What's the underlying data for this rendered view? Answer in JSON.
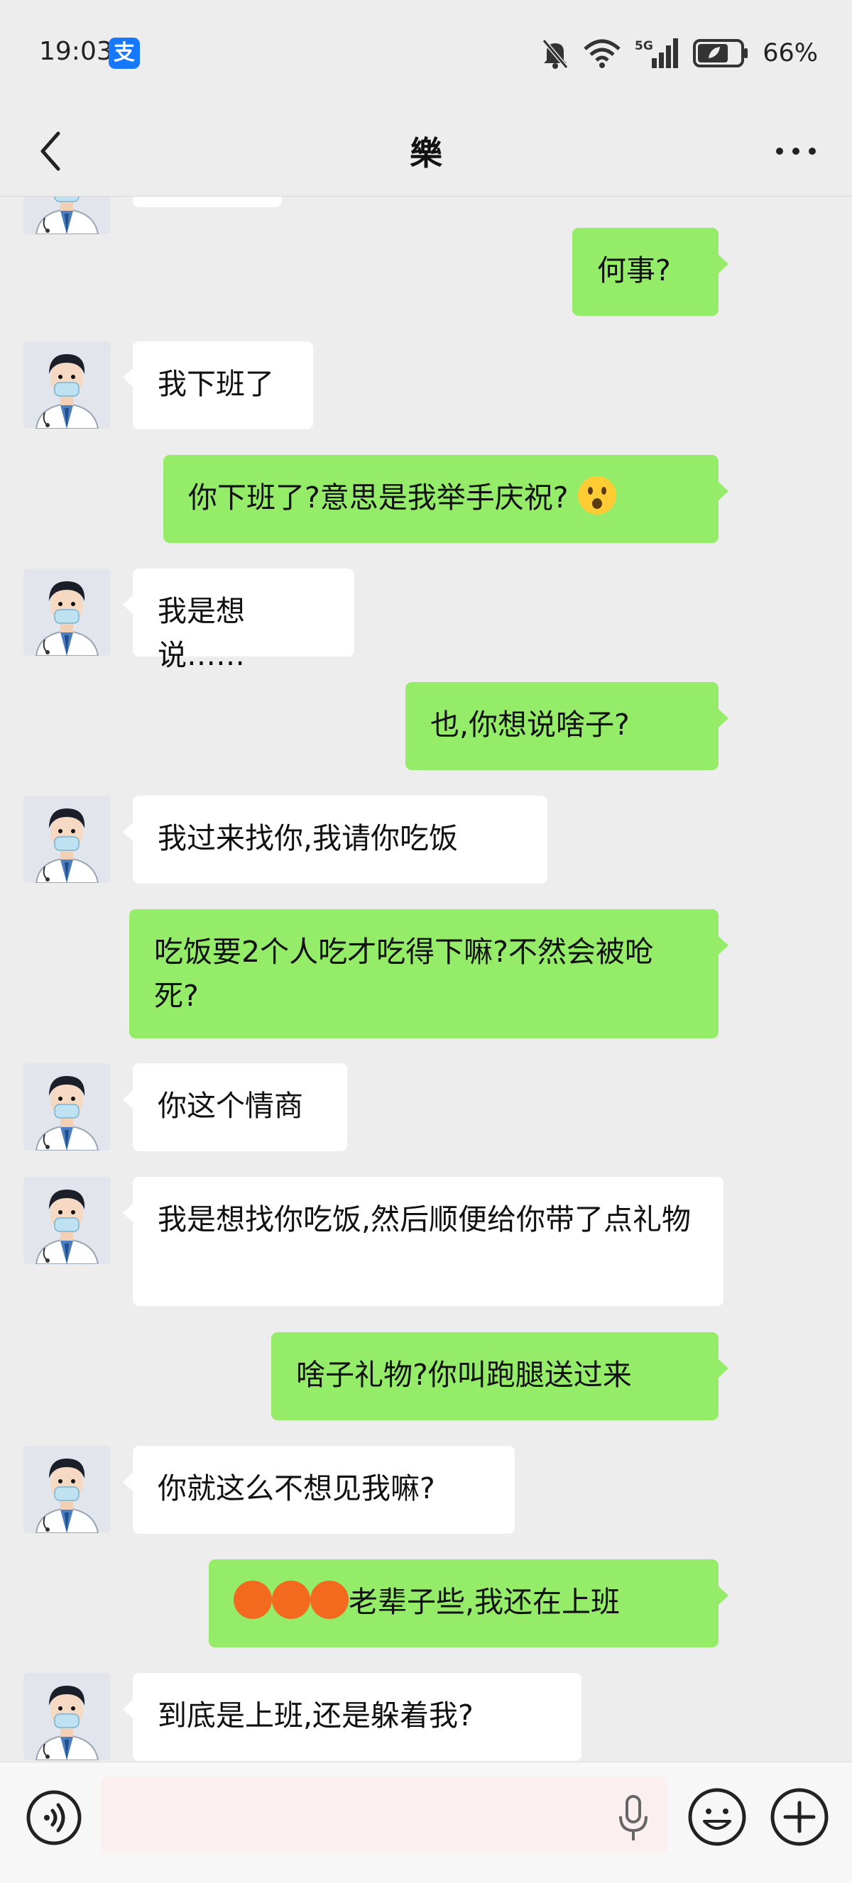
{
  "status_bar": {
    "time": "19:03",
    "alipay_icon": "alipay-icon",
    "battery": "66%",
    "network": "5G"
  },
  "header": {
    "title": "樂",
    "back_icon": "back-chevron-icon",
    "more_icon": "more-icon"
  },
  "messages": [
    {
      "from": "me",
      "text": "何事?"
    },
    {
      "from": "them",
      "text": "我下班了"
    },
    {
      "from": "me",
      "text": "你下班了?意思是我举手庆祝?",
      "emoji": "surprised-face"
    },
    {
      "from": "them",
      "text": "我是想说……"
    },
    {
      "from": "me",
      "text": "也,你想说啥子?"
    },
    {
      "from": "them",
      "text": "我过来找你,我请你吃饭"
    },
    {
      "from": "me",
      "text": "吃饭要2个人吃才吃得下嘛?不然会被呛死?"
    },
    {
      "from": "them",
      "text": "你这个情商"
    },
    {
      "from": "them",
      "text": "我是想找你吃饭,然后顺便给你带了点礼物"
    },
    {
      "from": "me",
      "text": "啥子礼物?你叫跑腿送过来"
    },
    {
      "from": "them",
      "text": "你就这么不想见我嘛?"
    },
    {
      "from": "me",
      "text": "老辈子些,我还在上班",
      "prefix_emojis": 3
    },
    {
      "from": "them",
      "text": "到底是上班,还是躲着我?"
    }
  ],
  "input_bar": {
    "placeholder": "",
    "voice_icon": "voice-icon",
    "mic_icon": "microphone-icon",
    "emoji_icon": "emoji-icon",
    "plus_icon": "plus-icon"
  },
  "colors": {
    "background": "#ededed",
    "outgoing_bubble": "#95ec69",
    "incoming_bubble": "#ffffff",
    "alipay_blue": "#1677ff"
  }
}
